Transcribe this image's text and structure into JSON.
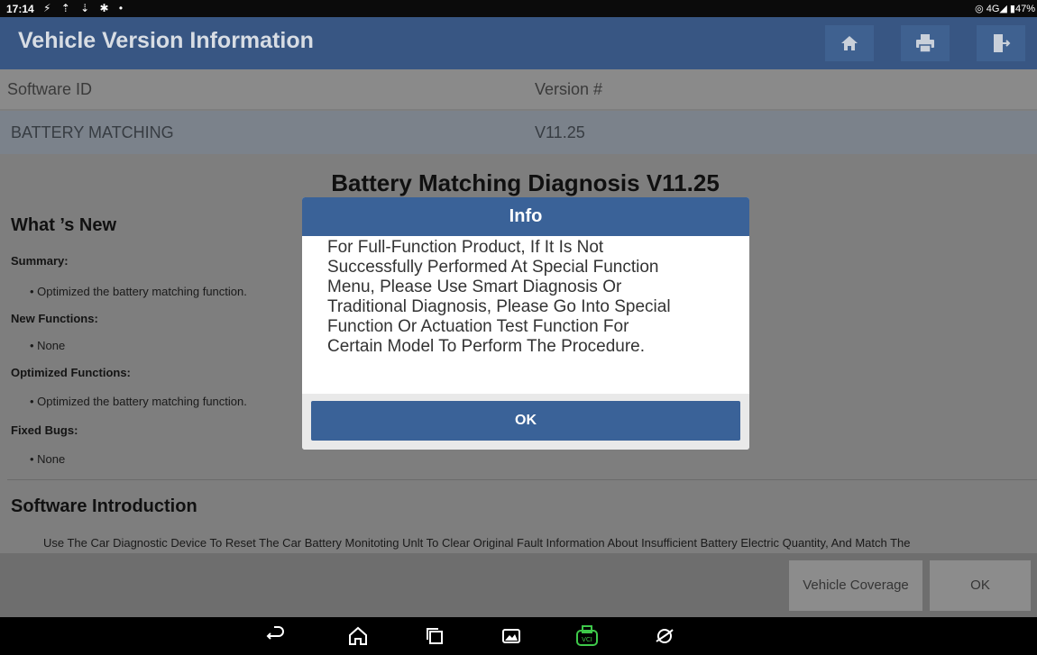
{
  "status_bar": {
    "time": "17:14",
    "left_icons": "⚡ ⇡ ⇣ ✱ •",
    "right_info": "◎ 4G◢ ▮47%"
  },
  "header": {
    "title": "Vehicle Version Information",
    "home_icon": "home-icon",
    "print_icon": "print-icon",
    "exit_icon": "exit-icon"
  },
  "version_table": {
    "headers": [
      "Software ID",
      "Version #"
    ],
    "rows": [
      {
        "software_id": "BATTERY MATCHING",
        "version": "V11.25"
      }
    ]
  },
  "content": {
    "doc_title": "Battery Matching Diagnosis V11.25",
    "whats_new": "What ’s New",
    "sections": [
      {
        "label": "Summary:",
        "item": "Optimized the battery matching function."
      },
      {
        "label": "New Functions:",
        "item": "None"
      },
      {
        "label": "Optimized Functions:",
        "item": "Optimized the battery matching function."
      },
      {
        "label": "Fixed Bugs:",
        "item": "None"
      }
    ],
    "intro_title": "Software Introduction",
    "intro_text": "Use The Car Diagnostic Device To Reset The Car Battery Monitoting Unlt To Clear Original Fault Information About Insufficient Battery Electric Quantity, And Match The"
  },
  "bottom_bar": {
    "vehicle_coverage_label": "Vehicle Coverage",
    "ok_label": "OK"
  },
  "modal": {
    "title": "Info",
    "lines": [
      "For Full-Function Product, If It Is Not",
      "Successfully Performed At Special Function",
      "Menu, Please Use Smart Diagnosis Or",
      "Traditional Diagnosis, Please Go Into Special",
      "Function Or Actuation Test Function For",
      "Certain Model To Perform The Procedure."
    ],
    "ok_label": "OK"
  },
  "nav_bar": {
    "icons": [
      "back-icon",
      "home-icon",
      "recents-icon",
      "gallery-icon",
      "vci-icon",
      "browser-icon"
    ]
  }
}
